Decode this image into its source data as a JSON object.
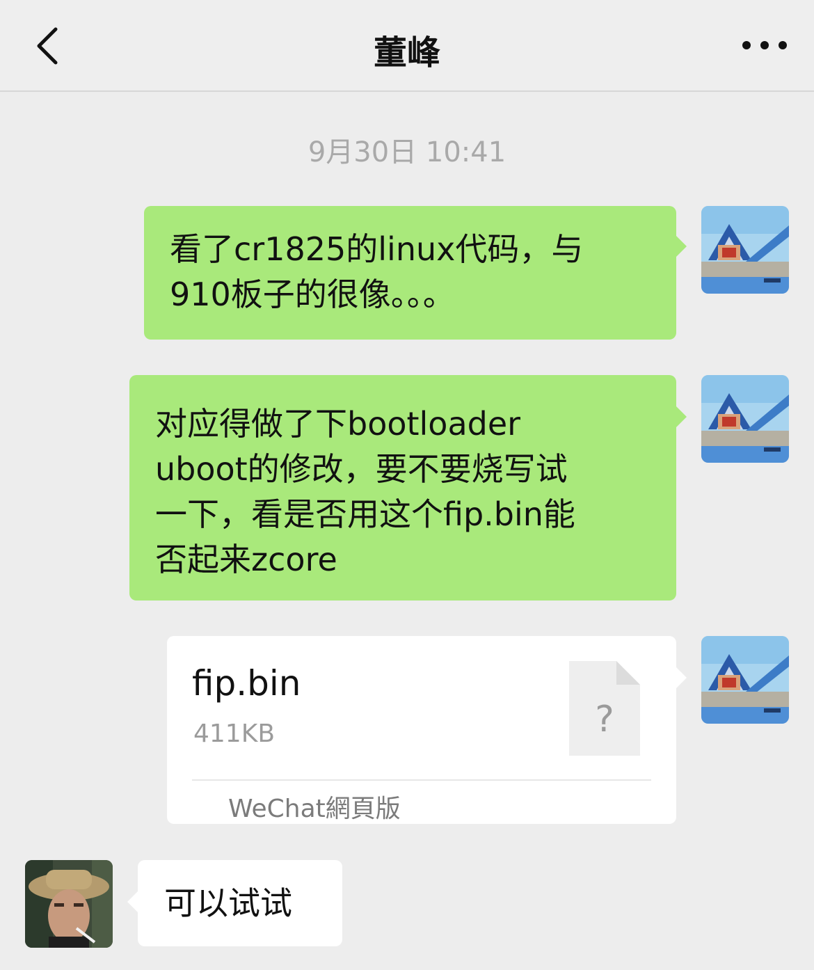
{
  "header": {
    "title": "董峰",
    "back_icon": "chevron-left-icon",
    "more_icon": "more-horizontal-icon"
  },
  "conversation": {
    "timestamp": "9月30日 10:41",
    "messages": [
      {
        "sender": "me",
        "type": "text",
        "lines": [
          "看了cr1825的linux代码，与",
          "910板子的很像。。。"
        ]
      },
      {
        "sender": "me",
        "type": "text",
        "lines": [
          "对应得做了下bootloader",
          "uboot的修改，要不要烧写试",
          "一下，看是否用这个fip.bin能",
          "否起来zcore"
        ]
      },
      {
        "sender": "me",
        "type": "file",
        "file_name": "fip.bin",
        "file_size": "411KB",
        "file_icon_glyph": "?",
        "source": "WeChat網頁版"
      },
      {
        "sender": "peer",
        "type": "text",
        "lines": [
          "可以试试"
        ]
      }
    ]
  },
  "colors": {
    "background": "#ededed",
    "outgoing_bubble": "#a9e97b",
    "incoming_bubble": "#ffffff",
    "timestamp_text": "#a9a9a9"
  }
}
